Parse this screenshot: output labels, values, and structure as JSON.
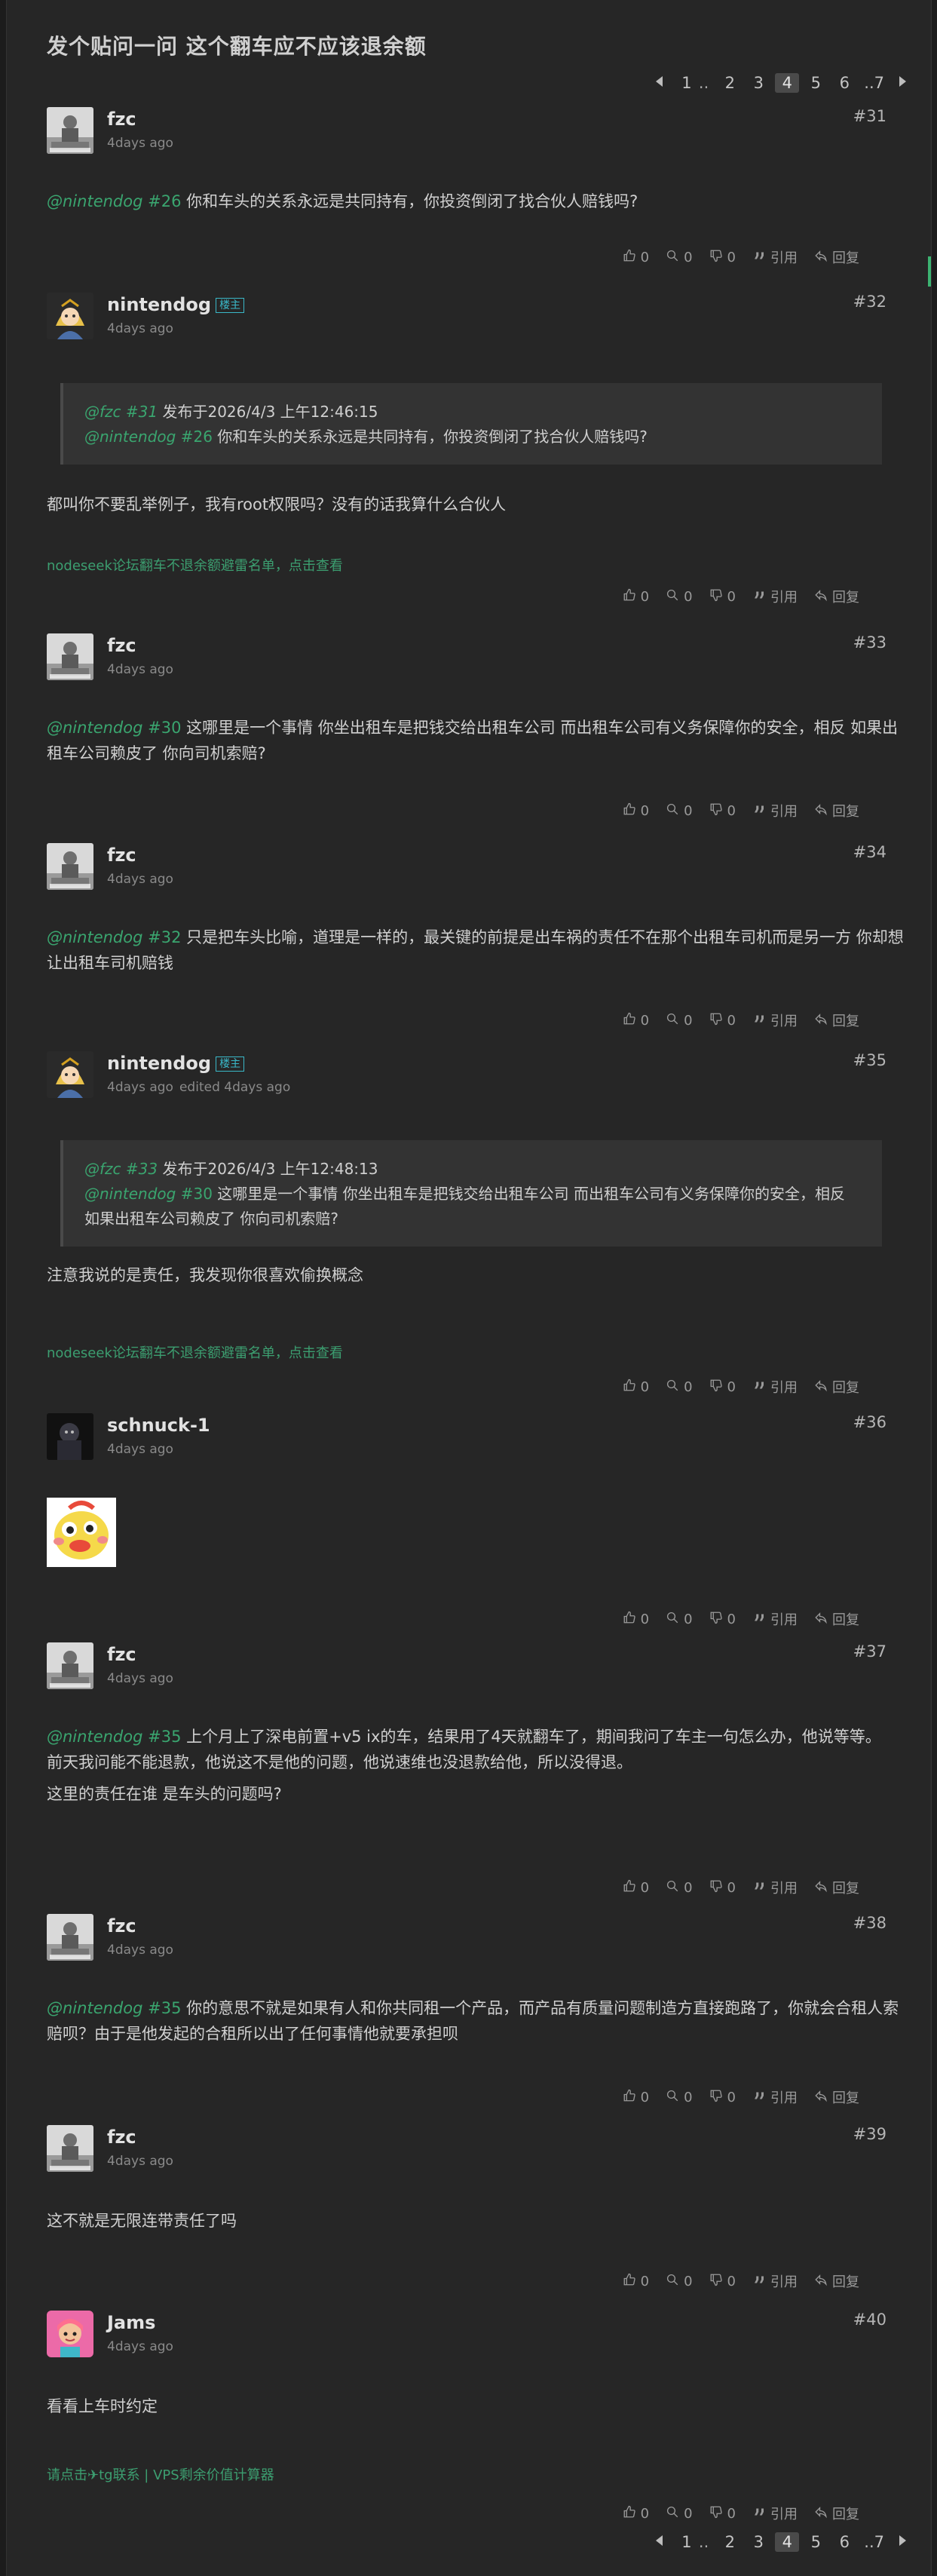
{
  "thread": {
    "title": "发个贴问一问 这个翻车应不应该退余额"
  },
  "pagination": {
    "pages": [
      {
        "label": "1",
        "current": false,
        "sep": ".."
      },
      {
        "label": "2",
        "current": false
      },
      {
        "label": "3",
        "current": false
      },
      {
        "label": "4",
        "current": true
      },
      {
        "label": "5",
        "current": false
      },
      {
        "label": "6",
        "current": false
      },
      {
        "label": "..7",
        "current": false
      }
    ]
  },
  "icons": {
    "prev": "caret-left-icon",
    "next": "caret-right-icon",
    "like": "thumbs-up-icon",
    "search": "magnify-icon",
    "dislike": "thumbs-down-icon",
    "quote": "quote-icon",
    "reply": "reply-icon"
  },
  "actions": {
    "like_count": "0",
    "search_count": "0",
    "dislike_count": "0",
    "quote_label": "引用",
    "reply_label": "回复"
  },
  "colors": {
    "accent_green": "#3aa56f",
    "badge_cyan": "#3ab8c8",
    "background": "#262626"
  },
  "posts": [
    {
      "user": "fzc",
      "time": "4days ago",
      "floor": "#31",
      "body": [
        {
          "mention": "@nintendog",
          "ref": "#26",
          "text": " 你和车头的关系永远是共同持有，你投资倒闭了找合伙人赔钱吗?"
        }
      ]
    },
    {
      "user": "nintendog",
      "badge": "楼主",
      "time": "4days ago",
      "floor": "#32",
      "quote": {
        "mention": "@fzc",
        "ref": "#31",
        "meta": " 发布于2026/4/3 上午12:46:15",
        "mention2": "@nintendog",
        "ref2": "#26",
        "text": " 你和车头的关系永远是共同持有，你投资倒闭了找合伙人赔钱吗?"
      },
      "body": [
        {
          "text": "都叫你不要乱举例子，我有root权限吗？没有的话我算什么合伙人"
        }
      ],
      "signature": "nodeseek论坛翻车不退余额避雷名单，点击查看"
    },
    {
      "user": "fzc",
      "time": "4days ago",
      "floor": "#33",
      "body": [
        {
          "mention": "@nintendog",
          "ref": "#30",
          "text": " 这哪里是一个事情 你坐出租车是把钱交给出租车公司 而出租车公司有义务保障你的安全，相反 如果出租车公司赖皮了 你向司机索赔?"
        }
      ]
    },
    {
      "user": "fzc",
      "time": "4days ago",
      "floor": "#34",
      "body": [
        {
          "mention": "@nintendog",
          "ref": "#32",
          "text": " 只是把车头比喻，道理是一样的，最关键的前提是出车祸的责任不在那个出租车司机而是另一方 你却想让出租车司机赔钱"
        }
      ]
    },
    {
      "user": "nintendog",
      "badge": "楼主",
      "time": "4days ago",
      "edited": "edited 4days ago",
      "floor": "#35",
      "quote": {
        "mention": "@fzc",
        "ref": "#33",
        "meta": " 发布于2026/4/3 上午12:48:13",
        "mention2": "@nintendog",
        "ref2": "#30",
        "text": " 这哪里是一个事情 你坐出租车是把钱交给出租车公司 而出租车公司有义务保障你的安全，相反 如果出租车公司赖皮了 你向司机索赔?"
      },
      "body": [
        {
          "text": "注意我说的是责任，我发现你很喜欢偷换概念"
        }
      ],
      "signature": "nodeseek论坛翻车不退余额避雷名单，点击查看"
    },
    {
      "user": "schnuck-1",
      "time": "4days ago",
      "floor": "#36",
      "sticker": "duck-sticker"
    },
    {
      "user": "fzc",
      "time": "4days ago",
      "floor": "#37",
      "body": [
        {
          "mention": "@nintendog",
          "ref": "#35",
          "text": " 上个月上了深电前置+v5 ix的车，结果用了4天就翻车了，期间我问了车主一句怎么办，他说等等。"
        },
        {
          "text": "前天我问能不能退款，他说这不是他的问题，他说速维也没退款给他，所以没得退。"
        },
        {
          "text": "这里的责任在谁 是车头的问题吗?"
        }
      ]
    },
    {
      "user": "fzc",
      "time": "4days ago",
      "floor": "#38",
      "body": [
        {
          "mention": "@nintendog",
          "ref": "#35",
          "text": " 你的意思不就是如果有人和你共同租一个产品，而产品有质量问题制造方直接跑路了，你就会合租人索赔呗？由于是他发起的合租所以出了任何事情他就要承担呗"
        }
      ]
    },
    {
      "user": "fzc",
      "time": "4days ago",
      "floor": "#39",
      "body": [
        {
          "text": "这不就是无限连带责任了吗"
        }
      ]
    },
    {
      "user": "Jams",
      "time": "4days ago",
      "floor": "#40",
      "body": [
        {
          "text": "看看上车时约定"
        }
      ],
      "signature": "请点击✈tg联系 | VPS剩余价值计算器"
    }
  ]
}
